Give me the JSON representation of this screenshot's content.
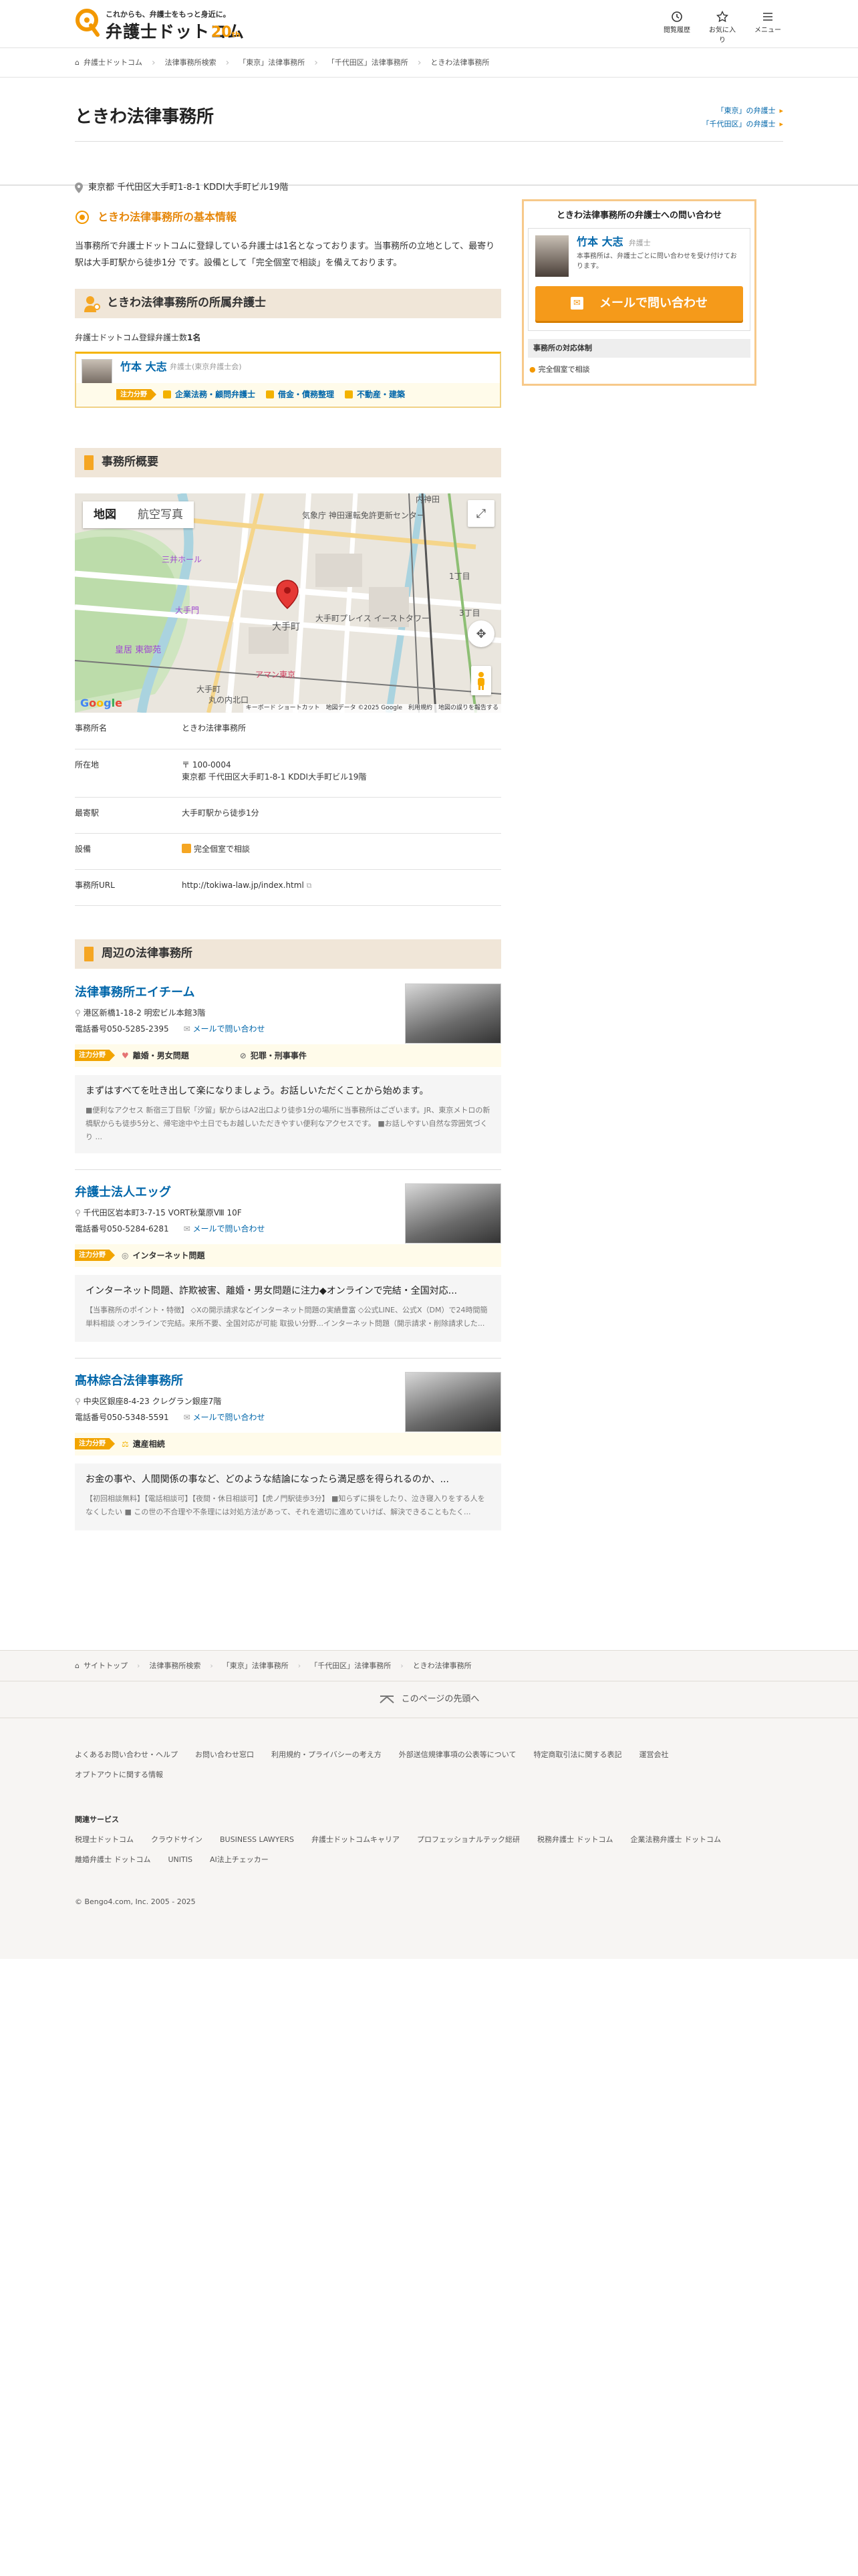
{
  "header": {
    "tagline": "これからも、弁護士をもっと身近に。",
    "logo_name": "弁護士ドットコム",
    "logo_badge": "20",
    "logo_badge_suffix": "th",
    "nav": [
      {
        "label": "閲覧履歴",
        "icon": "history-icon"
      },
      {
        "label": "お気に入り",
        "icon": "star-icon"
      },
      {
        "label": "メニュー",
        "icon": "menu-icon"
      }
    ]
  },
  "breadcrumb": [
    "弁護士ドットコム",
    "法律事務所検索",
    "「東京」法律事務所",
    "「千代田区」法律事務所",
    "ときわ法律事務所"
  ],
  "title": {
    "name": "ときわ法律事務所",
    "link1": "「東京」の弁護士",
    "link2": "「千代田区」の弁護士",
    "address": "東京都 千代田区大手町1-8-1 KDDI大手町ビル19階"
  },
  "basic": {
    "heading": "ときわ法律事務所の基本情報",
    "text": "当事務所で弁護士ドットコムに登録している弁護士は1名となっております。当事務所の立地として、最寄り駅は大手町駅から徒歩1分 です。設備として「完全個室で相談」を備えております。"
  },
  "lawyers": {
    "heading": "ときわ法律事務所の所属弁護士",
    "count_label": "弁護士ドットコム登録弁護士数",
    "count": "1名",
    "list": [
      {
        "name": "竹本 大志",
        "affiliation": "弁護士(東京弁護士会)",
        "badge": "注力分野",
        "fields": [
          "企業法務・顧問弁護士",
          "借金・債務整理",
          "不動産・建築"
        ]
      }
    ]
  },
  "overview": {
    "heading": "事務所概要",
    "map": {
      "tab_map": "地図",
      "tab_satellite": "航空写真",
      "attribution": "キーボード ショートカット　地図データ ©2025 Google　利用規約　地図の誤りを報告する",
      "labels": {
        "l1": "気象庁 神田運転免許更新センター",
        "l2": "皇居 東御苑",
        "l3": "大手門",
        "l4": "大手町",
        "l5": "大手町プレイス イーストタワー",
        "l6": "丸の内北口",
        "l7": "大手町",
        "l8": "三井ホール",
        "l9": "アマン東京",
        "l10": "3丁目",
        "l11": "1丁目",
        "l12": "内神田"
      }
    },
    "rows": [
      {
        "key": "事務所名",
        "value": "ときわ法律事務所"
      },
      {
        "key": "所在地",
        "value": "〒 100-0004",
        "value2": "東京都 千代田区大手町1-8-1 KDDI大手町ビル19階"
      },
      {
        "key": "最寄駅",
        "value": "大手町駅から徒歩1分"
      },
      {
        "key": "設備",
        "value": "完全個室で相談"
      },
      {
        "key": "事務所URL",
        "value": "http://tokiwa-law.jp/index.html"
      }
    ]
  },
  "nearby": {
    "heading": "周辺の法律事務所",
    "badge": "注力分野",
    "tel_prefix": "電話番号",
    "mail_label": "メールで問い合わせ",
    "firms": [
      {
        "name": "法律事務所エイチーム",
        "address": "港区新橋1-18-2 明宏ビル本館3階",
        "tel": "050-5285-2395",
        "fields": [
          "離婚・男女問題",
          "犯罪・刑事事件"
        ],
        "lead": "まずはすべてを吐き出して楽になりましょう。お話しいただくことから始めます。",
        "desc": "■便利なアクセス 新宿三丁目駅「汐留」駅からはA2出口より徒歩1分の場所に当事務所はございます。JR、東京メトロの新橋駅からも徒歩5分と、帰宅途中や土日でもお越しいただきやすい便利なアクセスです。 ■お話しやすい自然な雰囲気づくり ..."
      },
      {
        "name": "弁護士法人エッグ",
        "address": "千代田区岩本町3-7-15 VORT秋葉原Ⅷ 10F",
        "tel": "050-5284-6281",
        "fields": [
          "インターネット問題"
        ],
        "lead": "インターネット問題、詐欺被害、離婚・男女問題に注力◆オンラインで完結・全国対応...",
        "desc": "【当事務所のポイント・特徴】 ◇Xの開示請求などインターネット問題の実績豊富 ◇公式LINE、公式X（DM）で24時間簡単料相談 ◇オンラインで完結。来所不要、全国対応が可能 取扱い分野...インターネット問題（開示請求・削除請求した..."
      },
      {
        "name": "髙林綜合法律事務所",
        "address": "中央区銀座8-4-23 クレグラン銀座7階",
        "tel": "050-5348-5591",
        "fields": [
          "遺産相続"
        ],
        "lead": "お金の事や、人間関係の事など、どのような結論になったら満足感を得られるのか、...",
        "desc": "【初回相談無料】【電話相談可】【夜間・休日相談可】【虎ノ門駅徒歩3分】 ■知らずに損をしたり、泣き寝入りをする人をなくしたい ■ この世の不合理や不条理には対処方法があって、それを適切に進めていけば、解決できることもたく..."
      }
    ]
  },
  "sidebar": {
    "title": "ときわ法律事務所の弁護士への問い合わせ",
    "name": "竹本 大志",
    "role": "弁護士",
    "note": "本事務所は、弁護士ごとに問い合わせを受け付けております。",
    "mail_button": "メールで問い合わせ",
    "support_title": "事務所の対応体制",
    "support_item": "完全個室で相談"
  },
  "footer": {
    "breadcrumb": [
      "サイトトップ",
      "法律事務所検索",
      "「東京」法律事務所",
      "「千代田区」法律事務所",
      "ときわ法律事務所"
    ],
    "pagetop": "このページの先頭へ",
    "links": [
      "よくあるお問い合わせ・ヘルプ",
      "お問い合わせ窓口",
      "利用規約・プライバシーの考え方",
      "外部送信規律事項の公表等について",
      "特定商取引法に関する表記",
      "運営会社",
      "オプトアウトに関する情報"
    ],
    "services_title": "関連サービス",
    "services": [
      "税理士ドットコム",
      "クラウドサイン",
      "BUSINESS LAWYERS",
      "弁護士ドットコムキャリア",
      "プロフェッショナルテック総研",
      "税務弁護士 ドットコム",
      "企業法務弁護士 ドットコム",
      "離婚弁護士 ドットコム",
      "UNITIS",
      "AI法上チェッカー"
    ],
    "copyright": "© Bengo4.com, Inc. 2005 - 2025"
  }
}
